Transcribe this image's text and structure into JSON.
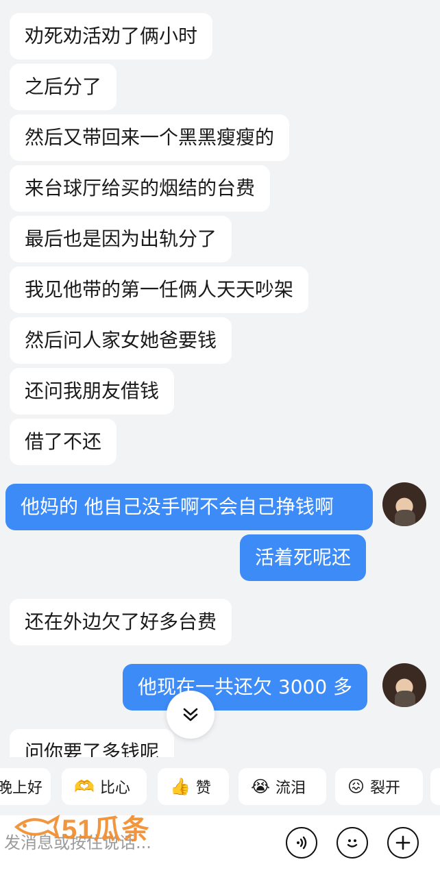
{
  "messages": [
    {
      "side": "left",
      "text": "劝死劝活劝了俩小时"
    },
    {
      "side": "left",
      "text": "之后分了"
    },
    {
      "side": "left",
      "text": "然后又带回来一个黑黑瘦瘦的"
    },
    {
      "side": "left",
      "text": "来台球厅给买的烟结的台费"
    },
    {
      "side": "left",
      "text": "最后也是因为出轨分了"
    },
    {
      "side": "left",
      "text": "我见他带的第一任俩人天天吵架"
    },
    {
      "side": "left",
      "text": "然后问人家女她爸要钱"
    },
    {
      "side": "left",
      "text": "还问我朋友借钱"
    },
    {
      "side": "left",
      "text": "借了不还"
    },
    {
      "side": "right",
      "text": "他妈的 他自己没手啊不会自己挣钱啊"
    },
    {
      "side": "right",
      "text": "活着死呢还"
    },
    {
      "side": "left",
      "text": "还在外边欠了好多台费"
    },
    {
      "side": "right",
      "text": "他现在一共还欠 3000 多"
    },
    {
      "side": "left",
      "text": "问你要了多钱呢"
    }
  ],
  "quick_replies": [
    {
      "label": "晚上好",
      "icon": ""
    },
    {
      "label": "比心",
      "icon": "heart-hands-icon"
    },
    {
      "label": "赞",
      "icon": "thumbs-up-icon"
    },
    {
      "label": "流泪",
      "icon": "crying-face-icon"
    },
    {
      "label": "裂开",
      "icon": "cracked-face-icon"
    }
  ],
  "input": {
    "placeholder": "发消息或按住说话..."
  },
  "watermark": {
    "text": "51瓜条"
  },
  "colors": {
    "accent": "#3d8bf6",
    "background": "#f2f3f5",
    "watermark": "#f08a2a"
  }
}
